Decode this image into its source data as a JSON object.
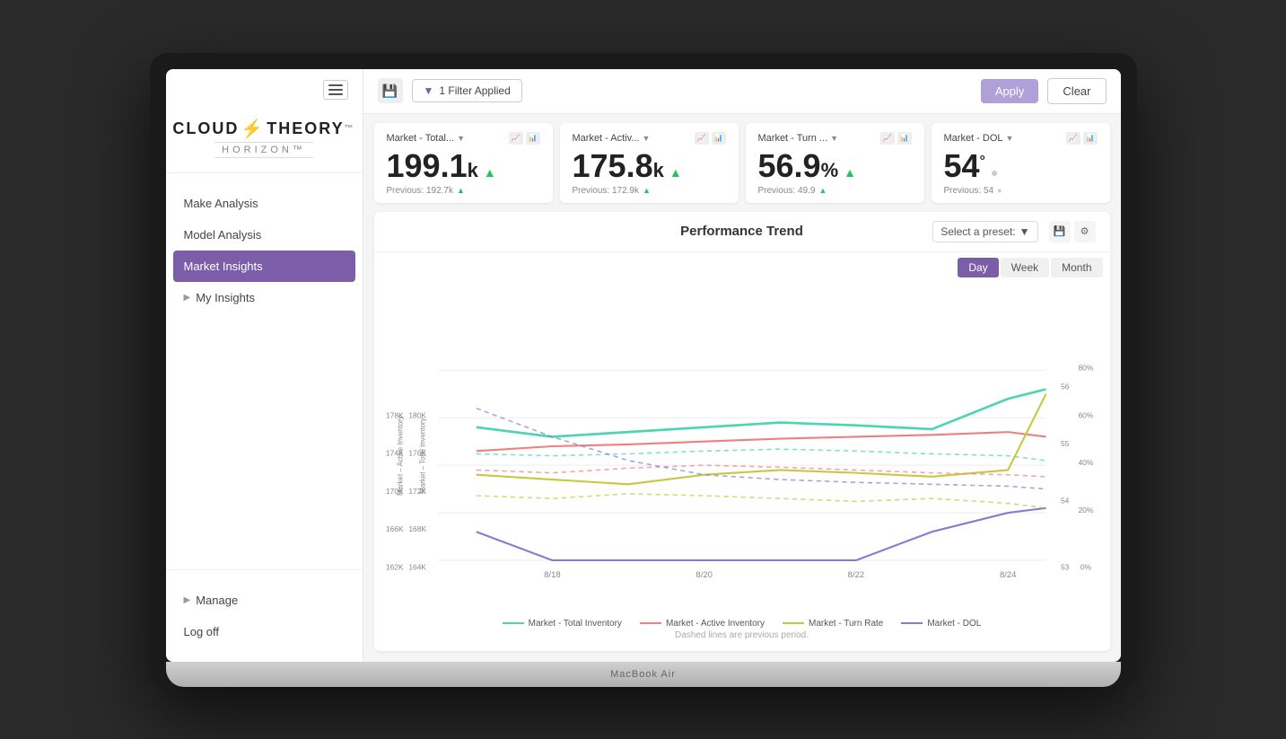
{
  "laptop": {
    "model": "MacBook Air"
  },
  "sidebar": {
    "menu_icon": "≡",
    "logo_left": "CLOUD",
    "logo_bolt": "⚡",
    "logo_right": "THEORY",
    "logo_trademark": "™",
    "logo_sub": "HORIZON™",
    "nav": [
      {
        "label": "Make Analysis",
        "active": false,
        "hasChevron": false
      },
      {
        "label": "Model Analysis",
        "active": false,
        "hasChevron": false
      },
      {
        "label": "Market Insights",
        "active": true,
        "hasChevron": false
      },
      {
        "label": "My Insights",
        "active": false,
        "hasChevron": true
      }
    ],
    "bottom_nav": [
      {
        "label": "Manage",
        "hasChevron": true
      },
      {
        "label": "Log off",
        "hasChevron": false
      }
    ]
  },
  "topbar": {
    "filter_label": "1 Filter Applied",
    "apply_label": "Apply",
    "clear_label": "Clear"
  },
  "kpi_cards": [
    {
      "title": "Market - Total...",
      "value": "199.1",
      "suffix": "k",
      "trend": "up",
      "prev_label": "Previous: 192.7k",
      "prev_trend": "up"
    },
    {
      "title": "Market - Activ...",
      "value": "175.8",
      "suffix": "k",
      "trend": "up",
      "prev_label": "Previous: 172.9k",
      "prev_trend": "up"
    },
    {
      "title": "Market - Turn ...",
      "value": "56.9",
      "suffix": "%",
      "trend": "up",
      "prev_label": "Previous: 49.9",
      "prev_trend": "up"
    },
    {
      "title": "Market - DOL",
      "value": "54",
      "suffix": "°",
      "trend": "dot",
      "prev_label": "Previous: 54",
      "prev_trend": "dot"
    }
  ],
  "chart": {
    "title": "Performance Trend",
    "preset_placeholder": "Select a preset:",
    "period_buttons": [
      "Day",
      "Week",
      "Month"
    ],
    "active_period": "Day",
    "legend": [
      {
        "label": "Market - Total Inventory",
        "color": "#4dd4b0",
        "dashed": false
      },
      {
        "label": "Market - Active Inventory",
        "color": "#f08080",
        "dashed": false
      },
      {
        "label": "Market - Turn Rate",
        "color": "#c8c840",
        "dashed": false
      },
      {
        "label": "Market - DOL",
        "color": "#8080d0",
        "dashed": false
      }
    ],
    "x_labels": [
      "8/18",
      "8/20",
      "8/22",
      "8/24"
    ],
    "y_left1_labels": [
      "162K",
      "166K",
      "170K",
      "174K",
      "178K"
    ],
    "y_left2_labels": [
      "164K",
      "168K",
      "172K",
      "176K",
      "180K"
    ],
    "y_right1_labels": [
      "53",
      "54",
      "55",
      "56"
    ],
    "y_right2_labels": [
      "0%",
      "20%",
      "40%",
      "60%",
      "80%"
    ],
    "note": "Dashed lines are previous period."
  }
}
